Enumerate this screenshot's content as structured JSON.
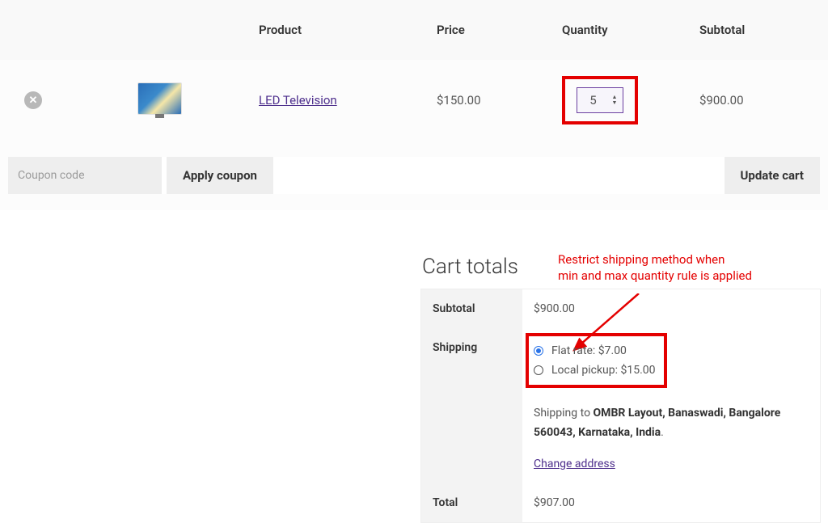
{
  "table": {
    "headers": {
      "product": "Product",
      "price": "Price",
      "quantity": "Quantity",
      "subtotal": "Subtotal"
    },
    "item": {
      "name": "LED Television",
      "price": "$150.00",
      "quantity": "5",
      "subtotal": "$900.00"
    }
  },
  "coupon": {
    "placeholder": "Coupon code",
    "apply_label": "Apply coupon",
    "update_label": "Update cart"
  },
  "totals": {
    "title": "Cart totals",
    "subtotal_label": "Subtotal",
    "subtotal_value": "$900.00",
    "shipping_label": "Shipping",
    "shipping_options": [
      {
        "label": "Flat rate: $7.00",
        "selected": true
      },
      {
        "label": "Local pickup: $15.00",
        "selected": false
      }
    ],
    "ship_to_prefix": "Shipping to ",
    "ship_to_bold": "OMBR Layout, Banaswadi, Bangalore 560043, Karnataka, India",
    "ship_to_suffix": ".",
    "change_address": "Change address",
    "total_label": "Total",
    "total_value": "$907.00"
  },
  "annotation": {
    "line1": "Restrict shipping method when",
    "line2": "min and max quantity rule is applied"
  }
}
